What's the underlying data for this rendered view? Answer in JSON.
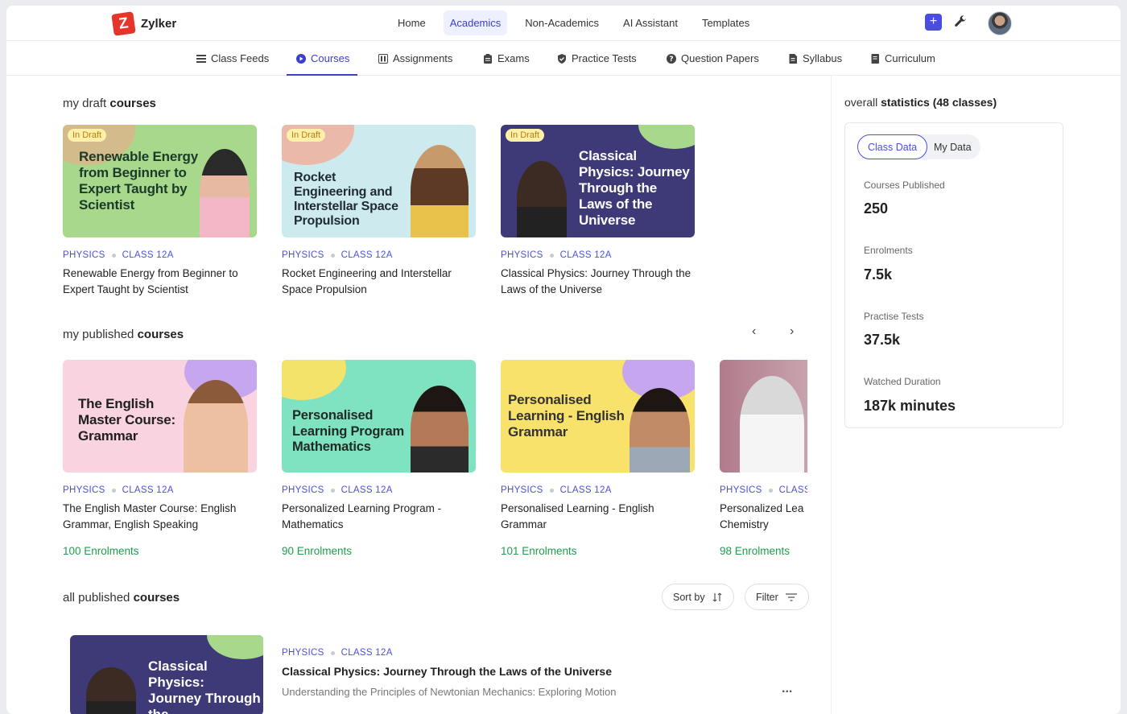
{
  "app": {
    "name": "Zylker",
    "logo_letter": "Z"
  },
  "top_nav": [
    {
      "label": "Home"
    },
    {
      "label": "Academics",
      "active": true
    },
    {
      "label": "Non-Academics"
    },
    {
      "label": "AI Assistant"
    },
    {
      "label": "Templates"
    }
  ],
  "header_actions": {
    "plus_label": "+"
  },
  "sub_nav": [
    {
      "label": "Class Feeds",
      "icon": "feed-icon"
    },
    {
      "label": "Courses",
      "icon": "play-circle-icon",
      "active": true
    },
    {
      "label": "Assignments",
      "icon": "assignments-icon"
    },
    {
      "label": "Exams",
      "icon": "clipboard-icon"
    },
    {
      "label": "Practice Tests",
      "icon": "shield-check-icon"
    },
    {
      "label": "Question Papers",
      "icon": "question-icon"
    },
    {
      "label": "Syllabus",
      "icon": "document-icon"
    },
    {
      "label": "Curriculum",
      "icon": "notebook-icon"
    }
  ],
  "draft": {
    "title_prefix": "my draft",
    "title_bold": "courses",
    "badge": "In Draft",
    "cards": [
      {
        "thumb_text": "Renewable Energy from Beginner to Expert Taught by Scientist",
        "subject": "PHYSICS",
        "class": "CLASS 12A",
        "title": "Renewable Energy from Beginner to Expert Taught by Scientist"
      },
      {
        "thumb_text": "Rocket Engineering and Interstellar Space Propulsion",
        "subject": "PHYSICS",
        "class": "CLASS 12A",
        "title": "Rocket Engineering and Interstellar Space Propulsion"
      },
      {
        "thumb_text": "Classical Physics: Journey Through the Laws of the Universe",
        "subject": "PHYSICS",
        "class": "CLASS 12A",
        "title": "Classical Physics: Journey Through the Laws of the Universe"
      }
    ]
  },
  "published": {
    "title_prefix": "my published",
    "title_bold": "courses",
    "prev": "‹",
    "next": "›",
    "cards": [
      {
        "thumb_text": "The English Master Course: Grammar",
        "subject": "PHYSICS",
        "class": "CLASS 12A",
        "title": "The English Master Course: English Grammar, English Speaking",
        "enrolments": "100 Enrolments"
      },
      {
        "thumb_text": "Personalised Learning Program Mathematics",
        "subject": "PHYSICS",
        "class": "CLASS 12A",
        "title": "Personalized Learning Program - Mathematics",
        "enrolments": "90 Enrolments"
      },
      {
        "thumb_text": "Personalised Learning - English Grammar",
        "subject": "PHYSICS",
        "class": "CLASS 12A",
        "title": "Personalised Learning - English Grammar",
        "enrolments": "101 Enrolments"
      },
      {
        "thumb_text": "",
        "subject": "PHYSICS",
        "class": "CLASS",
        "title": "Personalized Lea Chemistry",
        "enrolments": "98 Enrolments"
      }
    ]
  },
  "all_published": {
    "title_prefix": "all published",
    "title_bold": "courses",
    "sort_label": "Sort by",
    "filter_label": "Filter",
    "item": {
      "thumb_text": "Classical Physics: Journey Through the",
      "subject": "PHYSICS",
      "class": "CLASS 12A",
      "title": "Classical Physics: Journey Through the Laws of the Universe",
      "description": "Understanding the Principles of Newtonian Mechanics: Exploring Motion",
      "more": "..."
    }
  },
  "stats": {
    "title_prefix": "overall",
    "title_bold": "statistics (48 classes)",
    "toggle": {
      "class_data": "Class Data",
      "my_data": "My Data"
    },
    "items": [
      {
        "label": "Courses Published",
        "value": "250"
      },
      {
        "label": "Enrolments",
        "value": "7.5k"
      },
      {
        "label": "Practise Tests",
        "value": "37.5k"
      },
      {
        "label": "Watched Duration",
        "value": "187k minutes"
      }
    ]
  }
}
